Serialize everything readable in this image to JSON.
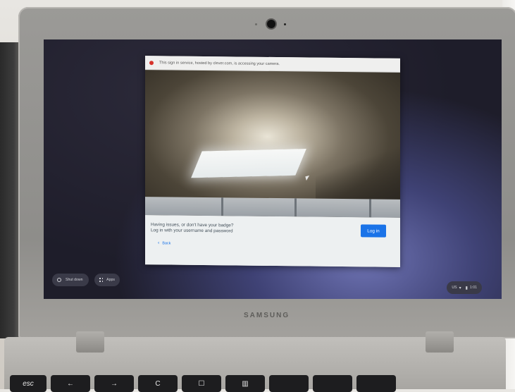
{
  "camera_banner": {
    "text": "This sign in service, hosted by clever.com, is accessing your camera."
  },
  "login_panel": {
    "help_line_1": "Having issues, or don't have your badge?",
    "help_line_2": "Log in with your username and password",
    "login_button": "Log in",
    "back_link": "Back"
  },
  "shelf": {
    "shutdown_label": "Shut down",
    "apps_label": "Apps"
  },
  "status_tray": {
    "keyboard_layout": "US",
    "time": "1:01"
  },
  "laptop": {
    "brand": "SAMSUNG"
  },
  "keyboard": {
    "keys": [
      "esc",
      "←",
      "→",
      "C",
      "☐",
      "▥"
    ]
  },
  "colors": {
    "accent": "#1a73e8",
    "recording_indicator": "#d6332b"
  }
}
